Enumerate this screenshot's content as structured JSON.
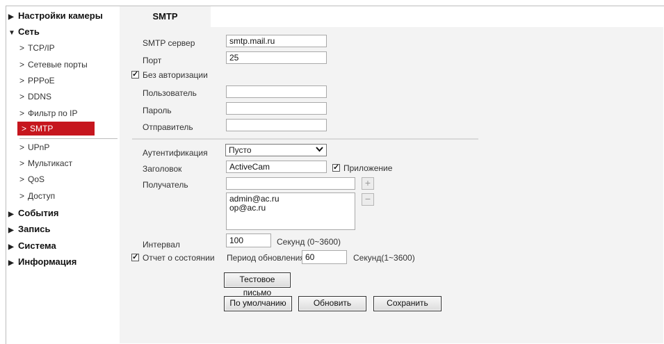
{
  "sidebar": {
    "groups": {
      "camera_settings": "Настройки камеры",
      "network": "Сеть",
      "events": "События",
      "record": "Запись",
      "system": "Система",
      "info": "Информация"
    },
    "network_items": [
      {
        "label": "TCP/IP"
      },
      {
        "label": "Сетевые порты"
      },
      {
        "label": "PPPoE"
      },
      {
        "label": "DDNS"
      },
      {
        "label": "Фильтр по IP"
      },
      {
        "label": "SMTP",
        "active": true
      },
      {
        "label": "UPnP"
      },
      {
        "label": "Мультикаст"
      },
      {
        "label": "QoS"
      },
      {
        "label": "Доступ"
      }
    ]
  },
  "tab": {
    "label": "SMTP"
  },
  "form": {
    "smtp_server": {
      "label": "SMTP сервер",
      "value": "smtp.mail.ru"
    },
    "port": {
      "label": "Порт",
      "value": "25"
    },
    "no_auth": {
      "label": "Без авторизации",
      "checked": true
    },
    "user": {
      "label": "Пользователь",
      "value": ""
    },
    "password": {
      "label": "Пароль",
      "value": ""
    },
    "sender": {
      "label": "Отправитель",
      "value": ""
    },
    "auth": {
      "label": "Аутентификация",
      "value": "Пусто"
    },
    "subject": {
      "label": "Заголовок",
      "value": "ActiveCam"
    },
    "attachment": {
      "label": "Приложение",
      "checked": true
    },
    "recipient": {
      "label": "Получатель",
      "value": "",
      "add_icon": "plus-icon",
      "remove_icon": "minus-icon"
    },
    "recipients_list": [
      "admin@ac.ru",
      "op@ac.ru"
    ],
    "interval": {
      "label": "Интервал",
      "value": "100",
      "unit": "Секунд (0~3600)"
    },
    "status_report": {
      "label": "Отчет о состоянии",
      "checked": true
    },
    "refresh_period": {
      "label": "Период обновления",
      "value": "60",
      "unit": "Секунд(1~3600)"
    }
  },
  "buttons": {
    "test_mail": "Тестовое письмо",
    "default": "По умолчанию",
    "refresh": "Обновить",
    "save": "Сохранить"
  },
  "colors": {
    "accent": "#c6161e",
    "panel_bg": "#f3f3f3"
  }
}
